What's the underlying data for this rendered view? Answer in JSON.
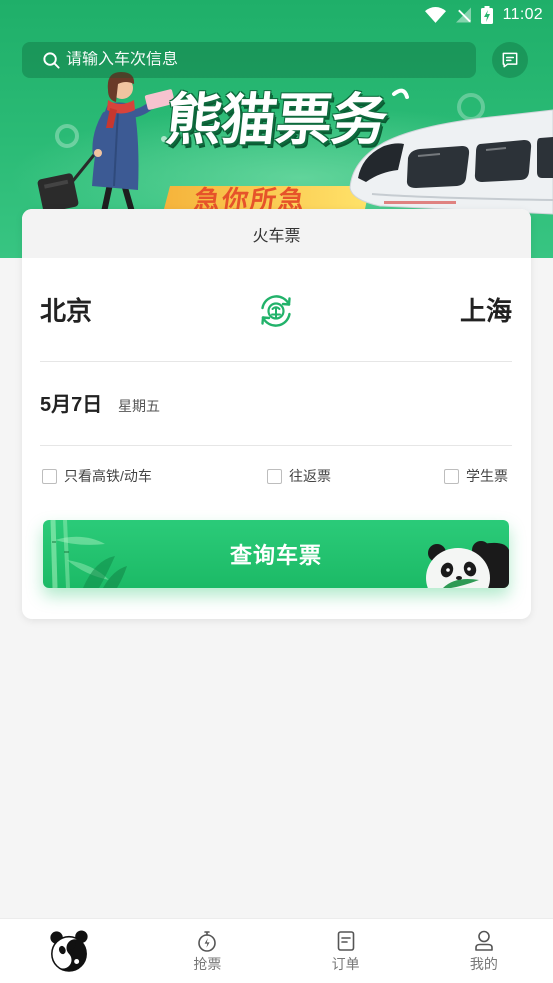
{
  "status_bar": {
    "time": "11:02"
  },
  "header": {
    "search_placeholder": "请输入车次信息",
    "banner_title": "熊猫票务",
    "banner_slogan": "急你所急"
  },
  "card": {
    "tab_label": "火车票",
    "from_station": "北京",
    "to_station": "上海",
    "date": "5月7日",
    "weekday": "星期五",
    "options": [
      {
        "label": "只看高铁/动车",
        "checked": false
      },
      {
        "label": "往返票",
        "checked": false
      },
      {
        "label": "学生票",
        "checked": false
      }
    ],
    "search_button_label": "查询车票"
  },
  "bottom_nav": {
    "items": [
      {
        "icon": "panda-logo-icon",
        "active": true
      },
      {
        "label": "抢票",
        "icon": "stopwatch-icon",
        "active": false
      },
      {
        "label": "订单",
        "icon": "order-document-icon",
        "active": false
      },
      {
        "label": "我的",
        "icon": "user-icon",
        "active": false
      }
    ]
  },
  "icons": {
    "status": [
      "wifi-icon",
      "no-sim-icon",
      "battery-charging-icon"
    ],
    "search": "search-icon",
    "message": "message-icon",
    "swap": "swap-stations-icon"
  },
  "colors": {
    "accent": "#1fb765",
    "banner_green": "#2bbb76",
    "page_background": "#f5f5f5"
  }
}
